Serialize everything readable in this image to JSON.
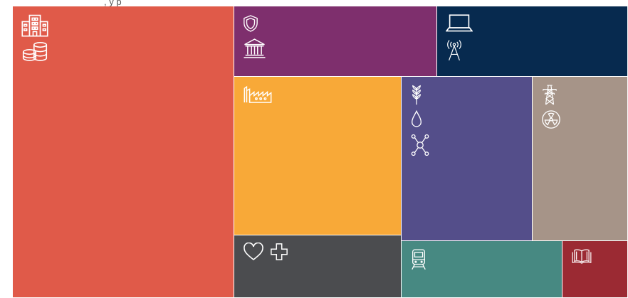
{
  "top_caption": ", y p",
  "chart_data": {
    "type": "treemap",
    "title": "",
    "note": "",
    "cells": [
      {
        "key": "buildings-finance",
        "value": 38.0,
        "color": "#E05A49",
        "icons": [
          "office-building-icon",
          "coin-stack-icon"
        ]
      },
      {
        "key": "security-government",
        "value": 8.4,
        "color": "#7E2F6D",
        "icons": [
          "shield-icon",
          "government-building-icon"
        ]
      },
      {
        "key": "it-communications",
        "value": 7.9,
        "color": "#072A4F",
        "icons": [
          "laptop-icon",
          "radio-tower-icon"
        ]
      },
      {
        "key": "manufacturing",
        "value": 15.6,
        "color": "#F8A938",
        "icons": [
          "factory-icon"
        ]
      },
      {
        "key": "food-water-chemicals",
        "value": 12.6,
        "color": "#544E8A",
        "icons": [
          "wheat-icon",
          "water-drop-icon",
          "molecule-icon"
        ]
      },
      {
        "key": "energy-nuclear",
        "value": 9.2,
        "color": "#A69488",
        "icons": [
          "power-pylon-icon",
          "radiation-icon"
        ]
      },
      {
        "key": "health",
        "value": 6.2,
        "color": "#4B4C4F",
        "icons": [
          "heart-icon",
          "medical-cross-icon"
        ]
      },
      {
        "key": "transport",
        "value": 5.4,
        "color": "#478982",
        "icons": [
          "train-icon"
        ]
      },
      {
        "key": "education",
        "value": 2.2,
        "color": "#9B2A33",
        "icons": [
          "book-icon"
        ]
      }
    ]
  }
}
